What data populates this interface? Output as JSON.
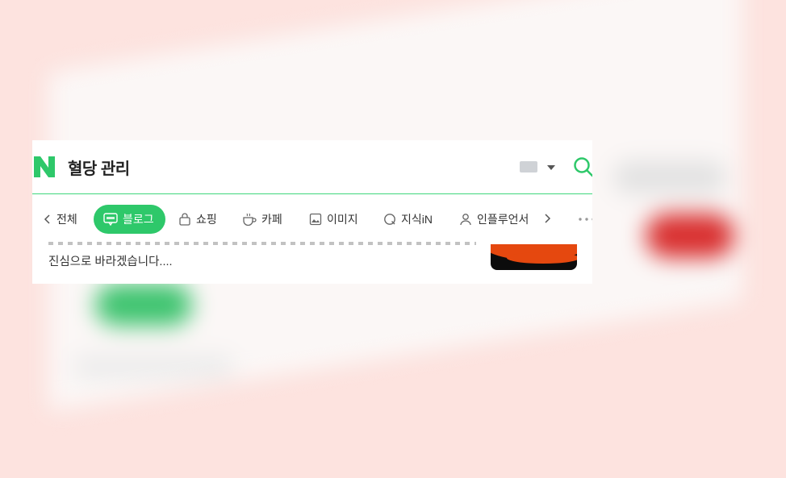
{
  "search": {
    "query": "혈당 관리"
  },
  "tabs": [
    {
      "label": "전체",
      "icon": "chevron-left-icon"
    },
    {
      "label": "블로그",
      "icon": "blog-icon",
      "active": true
    },
    {
      "label": "쇼핑",
      "icon": "shopping-bag-icon"
    },
    {
      "label": "카페",
      "icon": "cafe-cup-icon"
    },
    {
      "label": "이미지",
      "icon": "image-icon"
    },
    {
      "label": "지식iN",
      "icon": "knowledge-q-icon"
    },
    {
      "label": "인플루언서",
      "icon": "person-icon"
    }
  ],
  "result": {
    "snippet": "진심으로 바라겠습니다...."
  },
  "colors": {
    "accent": "#2ec86a",
    "background": "#fde3df"
  }
}
